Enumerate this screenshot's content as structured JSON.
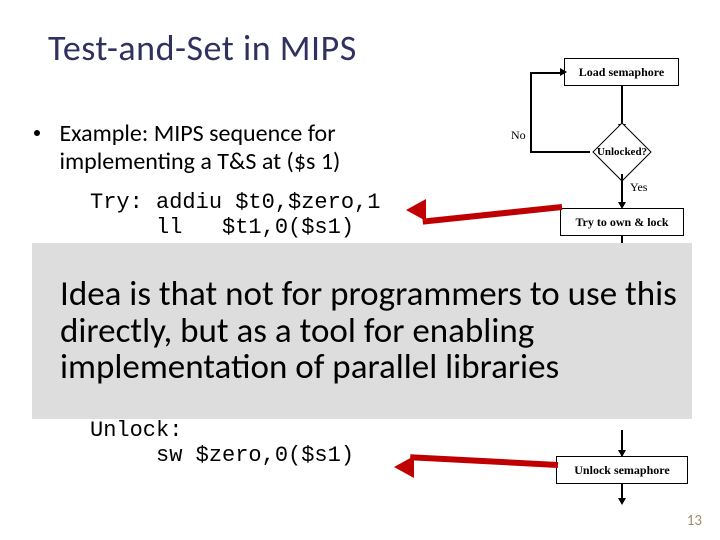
{
  "title": "Test-and-Set in MIPS",
  "bullet": {
    "line1": "Example: MIPS sequence for",
    "line2": "implementing a T&S at ($s 1)"
  },
  "code_top": "Try: addiu $t0,$zero,1\n     ll   $t1,0($s1)",
  "code_bottom": "Unlock:\n     sw $zero,0($s1)",
  "overlay_text": "Idea is that not for programmers to use this directly, but as a tool for enabling implementation of parallel libraries",
  "flow": {
    "load": "Load semaphore",
    "unlocked": "Unlocked?",
    "try": "Try to own & lock",
    "unlock": "Unlock semaphore",
    "no": "No",
    "yes": "Yes"
  },
  "page_number": "13"
}
